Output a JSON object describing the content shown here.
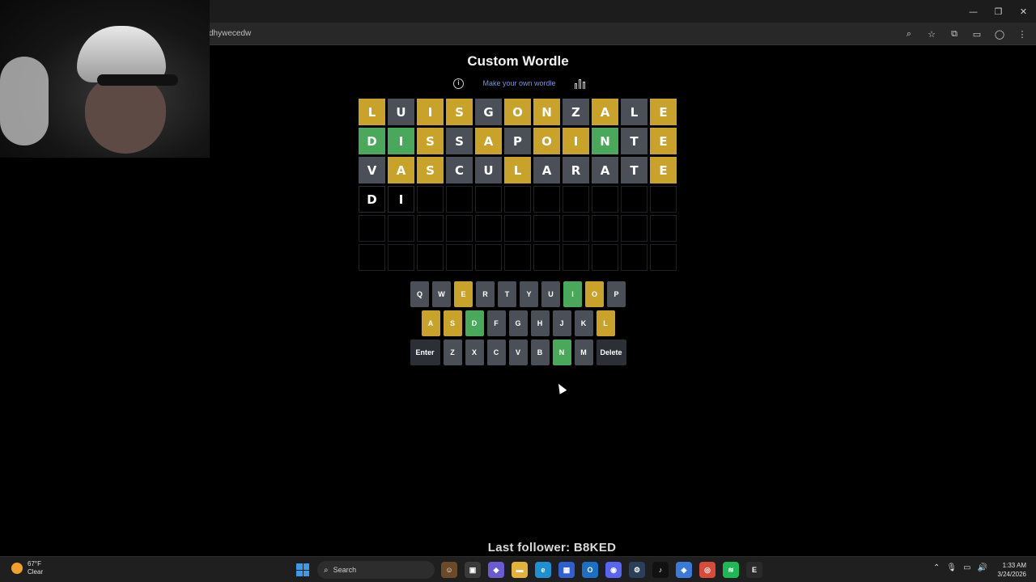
{
  "browser": {
    "url": "dhywecedw",
    "window_controls": [
      "—",
      "❐",
      "✕"
    ],
    "addr_icons": [
      "zoom-icon",
      "star-icon",
      "extensions-icon",
      "sidepanel-icon",
      "profile-icon",
      "menu-icon"
    ]
  },
  "page": {
    "title": "Custom Wordle",
    "make_link": "Make your own wordle"
  },
  "grid": [
    [
      {
        "l": "L",
        "s": "yellow"
      },
      {
        "l": "U",
        "s": "gray"
      },
      {
        "l": "I",
        "s": "yellow"
      },
      {
        "l": "S",
        "s": "yellow"
      },
      {
        "l": "G",
        "s": "gray"
      },
      {
        "l": "O",
        "s": "yellow"
      },
      {
        "l": "N",
        "s": "yellow"
      },
      {
        "l": "Z",
        "s": "gray"
      },
      {
        "l": "A",
        "s": "yellow"
      },
      {
        "l": "L",
        "s": "gray"
      },
      {
        "l": "E",
        "s": "yellow"
      }
    ],
    [
      {
        "l": "D",
        "s": "green"
      },
      {
        "l": "I",
        "s": "green"
      },
      {
        "l": "S",
        "s": "yellow"
      },
      {
        "l": "S",
        "s": "gray"
      },
      {
        "l": "A",
        "s": "yellow"
      },
      {
        "l": "P",
        "s": "gray"
      },
      {
        "l": "O",
        "s": "yellow"
      },
      {
        "l": "I",
        "s": "yellow"
      },
      {
        "l": "N",
        "s": "green"
      },
      {
        "l": "T",
        "s": "gray"
      },
      {
        "l": "E",
        "s": "yellow"
      }
    ],
    [
      {
        "l": "V",
        "s": "gray"
      },
      {
        "l": "A",
        "s": "yellow"
      },
      {
        "l": "S",
        "s": "yellow"
      },
      {
        "l": "C",
        "s": "gray"
      },
      {
        "l": "U",
        "s": "gray"
      },
      {
        "l": "L",
        "s": "yellow"
      },
      {
        "l": "A",
        "s": "gray"
      },
      {
        "l": "R",
        "s": "gray"
      },
      {
        "l": "A",
        "s": "gray"
      },
      {
        "l": "T",
        "s": "gray"
      },
      {
        "l": "E",
        "s": "yellow"
      }
    ],
    [
      {
        "l": "D",
        "s": "typed"
      },
      {
        "l": "I",
        "s": "typed"
      },
      {
        "l": "",
        "s": "empty"
      },
      {
        "l": "",
        "s": "empty"
      },
      {
        "l": "",
        "s": "empty"
      },
      {
        "l": "",
        "s": "empty"
      },
      {
        "l": "",
        "s": "empty"
      },
      {
        "l": "",
        "s": "empty"
      },
      {
        "l": "",
        "s": "empty"
      },
      {
        "l": "",
        "s": "empty"
      },
      {
        "l": "",
        "s": "empty"
      }
    ],
    [
      {
        "l": "",
        "s": "empty"
      },
      {
        "l": "",
        "s": "empty"
      },
      {
        "l": "",
        "s": "empty"
      },
      {
        "l": "",
        "s": "empty"
      },
      {
        "l": "",
        "s": "empty"
      },
      {
        "l": "",
        "s": "empty"
      },
      {
        "l": "",
        "s": "empty"
      },
      {
        "l": "",
        "s": "empty"
      },
      {
        "l": "",
        "s": "empty"
      },
      {
        "l": "",
        "s": "empty"
      },
      {
        "l": "",
        "s": "empty"
      }
    ],
    [
      {
        "l": "",
        "s": "empty"
      },
      {
        "l": "",
        "s": "empty"
      },
      {
        "l": "",
        "s": "empty"
      },
      {
        "l": "",
        "s": "empty"
      },
      {
        "l": "",
        "s": "empty"
      },
      {
        "l": "",
        "s": "empty"
      },
      {
        "l": "",
        "s": "empty"
      },
      {
        "l": "",
        "s": "empty"
      },
      {
        "l": "",
        "s": "empty"
      },
      {
        "l": "",
        "s": "empty"
      },
      {
        "l": "",
        "s": "empty"
      }
    ]
  ],
  "keyboard": [
    [
      {
        "k": "Q",
        "s": "gray"
      },
      {
        "k": "W",
        "s": "gray"
      },
      {
        "k": "E",
        "s": "yellow"
      },
      {
        "k": "R",
        "s": "gray"
      },
      {
        "k": "T",
        "s": "gray"
      },
      {
        "k": "Y",
        "s": "gray"
      },
      {
        "k": "U",
        "s": "gray"
      },
      {
        "k": "I",
        "s": "green"
      },
      {
        "k": "O",
        "s": "yellow"
      },
      {
        "k": "P",
        "s": "gray"
      }
    ],
    [
      {
        "k": "A",
        "s": "yellow"
      },
      {
        "k": "S",
        "s": "yellow"
      },
      {
        "k": "D",
        "s": "green"
      },
      {
        "k": "F",
        "s": "gray"
      },
      {
        "k": "G",
        "s": "gray"
      },
      {
        "k": "H",
        "s": "gray"
      },
      {
        "k": "J",
        "s": "gray"
      },
      {
        "k": "K",
        "s": "gray"
      },
      {
        "k": "L",
        "s": "yellow"
      }
    ],
    [
      {
        "k": "Enter",
        "s": "wide"
      },
      {
        "k": "Z",
        "s": "gray"
      },
      {
        "k": "X",
        "s": "gray"
      },
      {
        "k": "C",
        "s": "gray"
      },
      {
        "k": "V",
        "s": "gray"
      },
      {
        "k": "B",
        "s": "gray"
      },
      {
        "k": "N",
        "s": "green"
      },
      {
        "k": "M",
        "s": "gray"
      },
      {
        "k": "Delete",
        "s": "wide"
      }
    ]
  ],
  "overlay": {
    "follower": "Last follower: B8KED"
  },
  "taskbar": {
    "weather_temp": "67°F",
    "weather_cond": "Clear",
    "search": "Search",
    "apps": [
      {
        "name": "widgets-icon",
        "color": "#6b4a2a",
        "glyph": "☺"
      },
      {
        "name": "task-view-icon",
        "color": "#3a3a3a",
        "glyph": "▣"
      },
      {
        "name": "copilot-icon",
        "color": "#6a5bd1",
        "glyph": "◆"
      },
      {
        "name": "file-explorer-icon",
        "color": "#e2b23a",
        "glyph": "▬"
      },
      {
        "name": "edge-icon",
        "color": "#1f8fd1",
        "glyph": "e"
      },
      {
        "name": "store-icon",
        "color": "#2f5fd1",
        "glyph": "▦"
      },
      {
        "name": "outlook-icon",
        "color": "#1b6fc4",
        "glyph": "O"
      },
      {
        "name": "discord-icon",
        "color": "#5865f2",
        "glyph": "◉"
      },
      {
        "name": "steam-icon",
        "color": "#2a3f5a",
        "glyph": "⚙"
      },
      {
        "name": "tiktok-icon",
        "color": "#111111",
        "glyph": "♪"
      },
      {
        "name": "app-icon",
        "color": "#3b7bd8",
        "glyph": "◈"
      },
      {
        "name": "chrome-icon",
        "color": "#d94a38",
        "glyph": "◎"
      },
      {
        "name": "spotify-icon",
        "color": "#1db954",
        "glyph": "≋"
      },
      {
        "name": "epic-games-icon",
        "color": "#2a2a2a",
        "glyph": "E"
      }
    ],
    "tray": [
      "⌃",
      "🎙",
      "▭",
      "🔊"
    ],
    "time": "1:33 AM",
    "date": "3/24/2026"
  }
}
